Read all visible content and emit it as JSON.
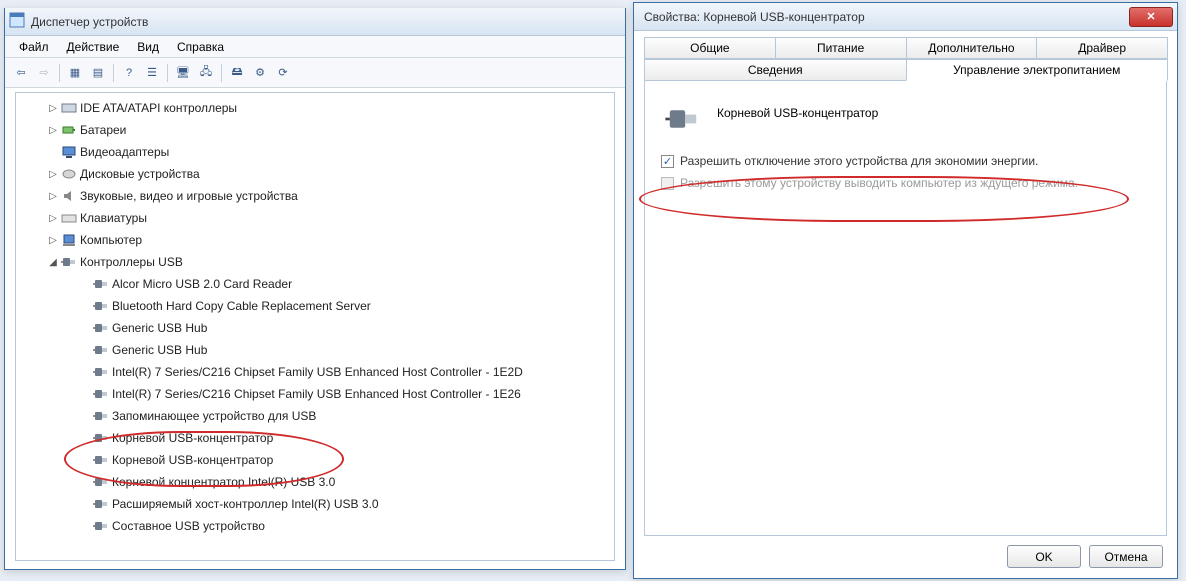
{
  "device_manager": {
    "title": "Диспетчер устройств",
    "menu": {
      "file": "Файл",
      "action": "Действие",
      "view": "Вид",
      "help": "Справка"
    },
    "nodes": [
      {
        "level": 1,
        "expander": "▷",
        "icon": "controller",
        "label": "IDE ATA/ATAPI контроллеры"
      },
      {
        "level": 1,
        "expander": "▷",
        "icon": "battery",
        "label": "Батареи"
      },
      {
        "level": 1,
        "expander": "",
        "icon": "display",
        "label": "Видеоадаптеры"
      },
      {
        "level": 1,
        "expander": "▷",
        "icon": "disk",
        "label": "Дисковые устройства"
      },
      {
        "level": 1,
        "expander": "▷",
        "icon": "sound",
        "label": "Звуковые, видео и игровые устройства"
      },
      {
        "level": 1,
        "expander": "▷",
        "icon": "keyboard",
        "label": "Клавиатуры"
      },
      {
        "level": 1,
        "expander": "▷",
        "icon": "computer",
        "label": "Компьютер"
      },
      {
        "level": 1,
        "expander": "◢",
        "icon": "usb",
        "label": "Контроллеры USB"
      },
      {
        "level": 2,
        "expander": "",
        "icon": "usb",
        "label": "Alcor Micro USB 2.0 Card Reader"
      },
      {
        "level": 2,
        "expander": "",
        "icon": "usb",
        "label": "Bluetooth Hard Copy Cable Replacement Server"
      },
      {
        "level": 2,
        "expander": "",
        "icon": "usb",
        "label": "Generic USB Hub"
      },
      {
        "level": 2,
        "expander": "",
        "icon": "usb",
        "label": "Generic USB Hub"
      },
      {
        "level": 2,
        "expander": "",
        "icon": "usb",
        "label": "Intel(R) 7 Series/C216 Chipset Family USB Enhanced Host Controller - 1E2D"
      },
      {
        "level": 2,
        "expander": "",
        "icon": "usb",
        "label": "Intel(R) 7 Series/C216 Chipset Family USB Enhanced Host Controller - 1E26"
      },
      {
        "level": 2,
        "expander": "",
        "icon": "usb",
        "label": "Запоминающее устройство для USB"
      },
      {
        "level": 2,
        "expander": "",
        "icon": "usb",
        "label": "Корневой USB-концентратор"
      },
      {
        "level": 2,
        "expander": "",
        "icon": "usb",
        "label": "Корневой USB-концентратор"
      },
      {
        "level": 2,
        "expander": "",
        "icon": "usb",
        "label": "Корневой концентратор Intel(R) USB 3.0"
      },
      {
        "level": 2,
        "expander": "",
        "icon": "usb",
        "label": "Расширяемый хост-контроллер Intel(R) USB 3.0"
      },
      {
        "level": 2,
        "expander": "",
        "icon": "usb",
        "label": "Составное USB устройство"
      }
    ]
  },
  "properties_dialog": {
    "title": "Свойства: Корневой USB-концентратор",
    "tabs_row1": [
      "Общие",
      "Питание",
      "Дополнительно",
      "Драйвер"
    ],
    "tabs_row2": [
      "Сведения",
      "Управление электропитанием"
    ],
    "active_tab": "Управление электропитанием",
    "device_name": "Корневой USB-концентратор",
    "checkbox1": {
      "label": "Разрешить отключение этого устройства для экономии энергии.",
      "checked": true,
      "disabled": false
    },
    "checkbox2": {
      "label": "Разрешить этому устройству выводить компьютер из ждущего режима.",
      "checked": false,
      "disabled": true
    },
    "buttons": {
      "ok": "OK",
      "cancel": "Отмена"
    }
  },
  "icons": {
    "usb_svg": "usb"
  }
}
